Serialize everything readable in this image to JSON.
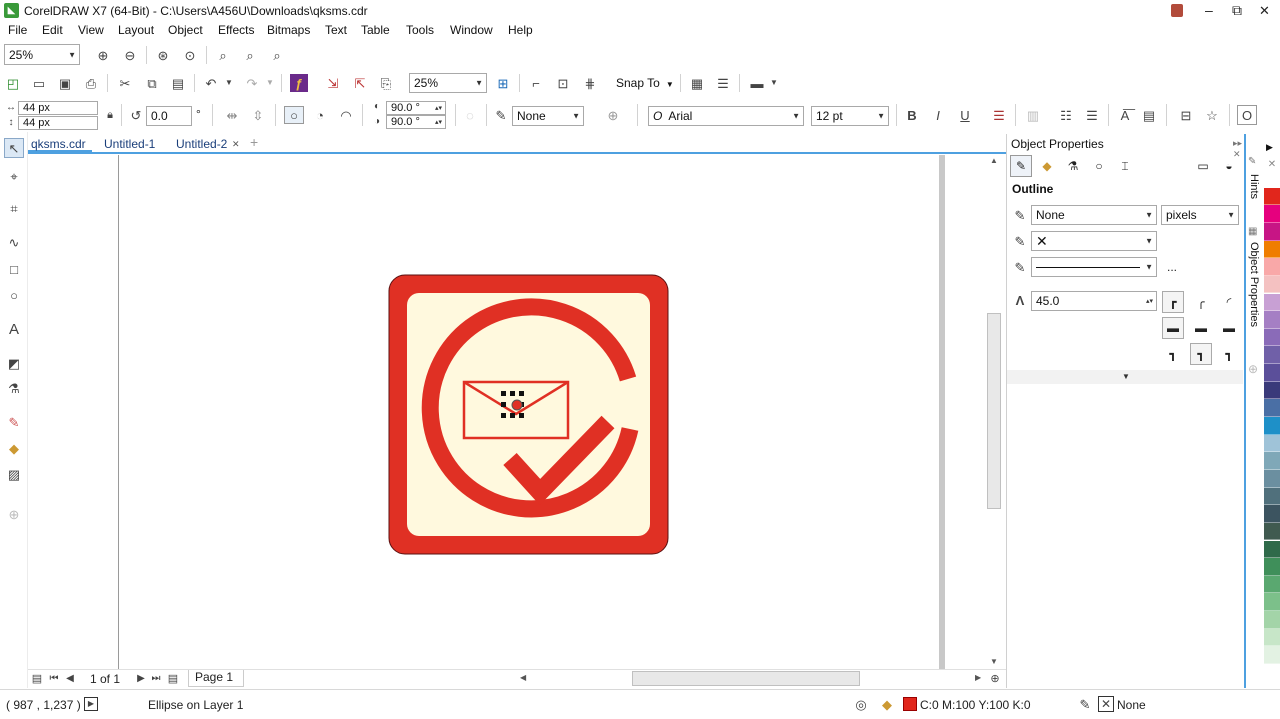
{
  "titlebar": {
    "title": "CorelDRAW X7 (64-Bit) - C:\\Users\\A456U\\Downloads\\qksms.cdr",
    "minimize": "–",
    "maximize": "⧉",
    "close": "✕"
  },
  "menu": [
    "File",
    "Edit",
    "View",
    "Layout",
    "Object",
    "Effects",
    "Bitmaps",
    "Text",
    "Table",
    "Tools",
    "Window",
    "Help"
  ],
  "zoom_small": "25%",
  "toolbar": {
    "zoom": "25%",
    "snap_to": "Snap To"
  },
  "propbar": {
    "width": "44 px",
    "height": "44 px",
    "rotation": "0.0",
    "degree_symbol": "°",
    "angle_start": "90.0 °",
    "angle_end": "90.0 °",
    "outline": "None",
    "font": "Arial",
    "font_size": "12 pt"
  },
  "tabs": [
    "qksms.cdr",
    "Untitled-1",
    "Untitled-2"
  ],
  "tab_close": "✕",
  "tab_add": "+",
  "panel": {
    "title": "Object Properties",
    "section": "Outline",
    "width_value": "None",
    "units": "pixels",
    "miter": "45.0",
    "more": "..."
  },
  "docker_tabs": [
    "Hints",
    "Object Properties"
  ],
  "page_nav": {
    "count": "1 of 1",
    "page": "Page 1"
  },
  "status": {
    "coords": "( 987 , 1,237 )",
    "object": "Ellipse on Layer 1",
    "fill": "C:0 M:100 Y:100 K:0",
    "outline": "None"
  },
  "colors": {
    "accent": "#e03024",
    "cream": "#fff9de"
  },
  "palette": [
    "#ffffff",
    "#e1261c",
    "#e6007e",
    "#c71585",
    "#ef7d00",
    "#f9a8a8",
    "#f4c1c1",
    "#c8a0d4",
    "#a57fc4",
    "#8a6bb8",
    "#7060a8",
    "#5b4f9a",
    "#3a3a7a",
    "#4a6fa5",
    "#1e90c8",
    "#9fc3d8",
    "#7fa8b8",
    "#6b8fa0",
    "#50707c",
    "#3c5460",
    "#405a50",
    "#2f6a4a",
    "#3f8f5a",
    "#5aa870",
    "#7cc08a",
    "#a3d4a8",
    "#c7e6c8",
    "#e3f2e3"
  ]
}
